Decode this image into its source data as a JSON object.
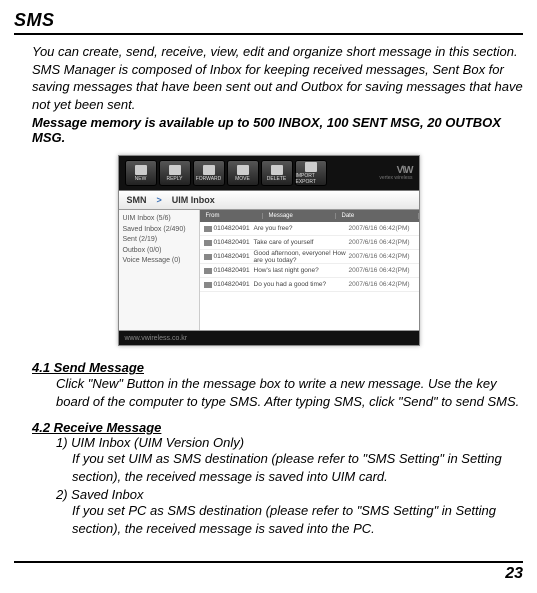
{
  "page_title": "SMS",
  "intro": "You can create, send, receive, view, edit and organize short message in this section. SMS Manager is composed of Inbox for keeping received messages, Sent Box for saving messages that have been sent out and Outbox for saving messages that have not yet been sent.",
  "memory_note": "Message memory is available up to 500 INBOX, 100 SENT MSG, 20 OUTBOX MSG.",
  "screenshot": {
    "toolbar": [
      "NEW",
      "REPLY",
      "FORWARD",
      "MOVE",
      "DELETE",
      "IMPORT EXPORT"
    ],
    "logo": "V\\W",
    "logo_sub": "vertex wireless",
    "breadcrumb": [
      "SMN",
      "UIM Inbox"
    ],
    "sidebar": [
      "UIM Inbox (5/6)",
      "Saved Inbox (2/490)",
      "Sent (2/19)",
      "Outbox (0/0)",
      "Voice Message (0)"
    ],
    "table_headers": [
      "From",
      "Message",
      "Date"
    ],
    "rows": [
      {
        "from": "0104820491",
        "msg": "Are you free?",
        "date": "2007/6/16 06:42(PM)"
      },
      {
        "from": "0104820491",
        "msg": "Take care of yourself",
        "date": "2007/6/16 06:42(PM)"
      },
      {
        "from": "0104820491",
        "msg": "Good afternoon, everyone! How are you today?",
        "date": "2007/6/16 06:42(PM)"
      },
      {
        "from": "0104820491",
        "msg": "How's last night gone?",
        "date": "2007/6/16 06:42(PM)"
      },
      {
        "from": "0104820491",
        "msg": "Do you had a good time?",
        "date": "2007/6/16 06:42(PM)"
      }
    ],
    "footer_url": "www.vwireless.co.kr"
  },
  "section_41_head": "4.1 Send Message",
  "section_41_body": "Click \"New\" Button in the message box to write a new message. Use the key board of the computer to type SMS. After typing SMS, click \"Send\" to send SMS.",
  "section_42_head": "4.2 Receive Message",
  "section_42_item1": "1) UIM Inbox (UIM Version Only)",
  "section_42_item1_body": "If you set UIM as SMS destination (please refer to \"SMS Setting\" in Setting section), the received message is saved into UIM card.",
  "section_42_item2": "2) Saved Inbox",
  "section_42_item2_body": "If you set PC as SMS destination (please refer to \"SMS Setting\" in Setting section), the received message is saved into the PC.",
  "page_number": "23"
}
